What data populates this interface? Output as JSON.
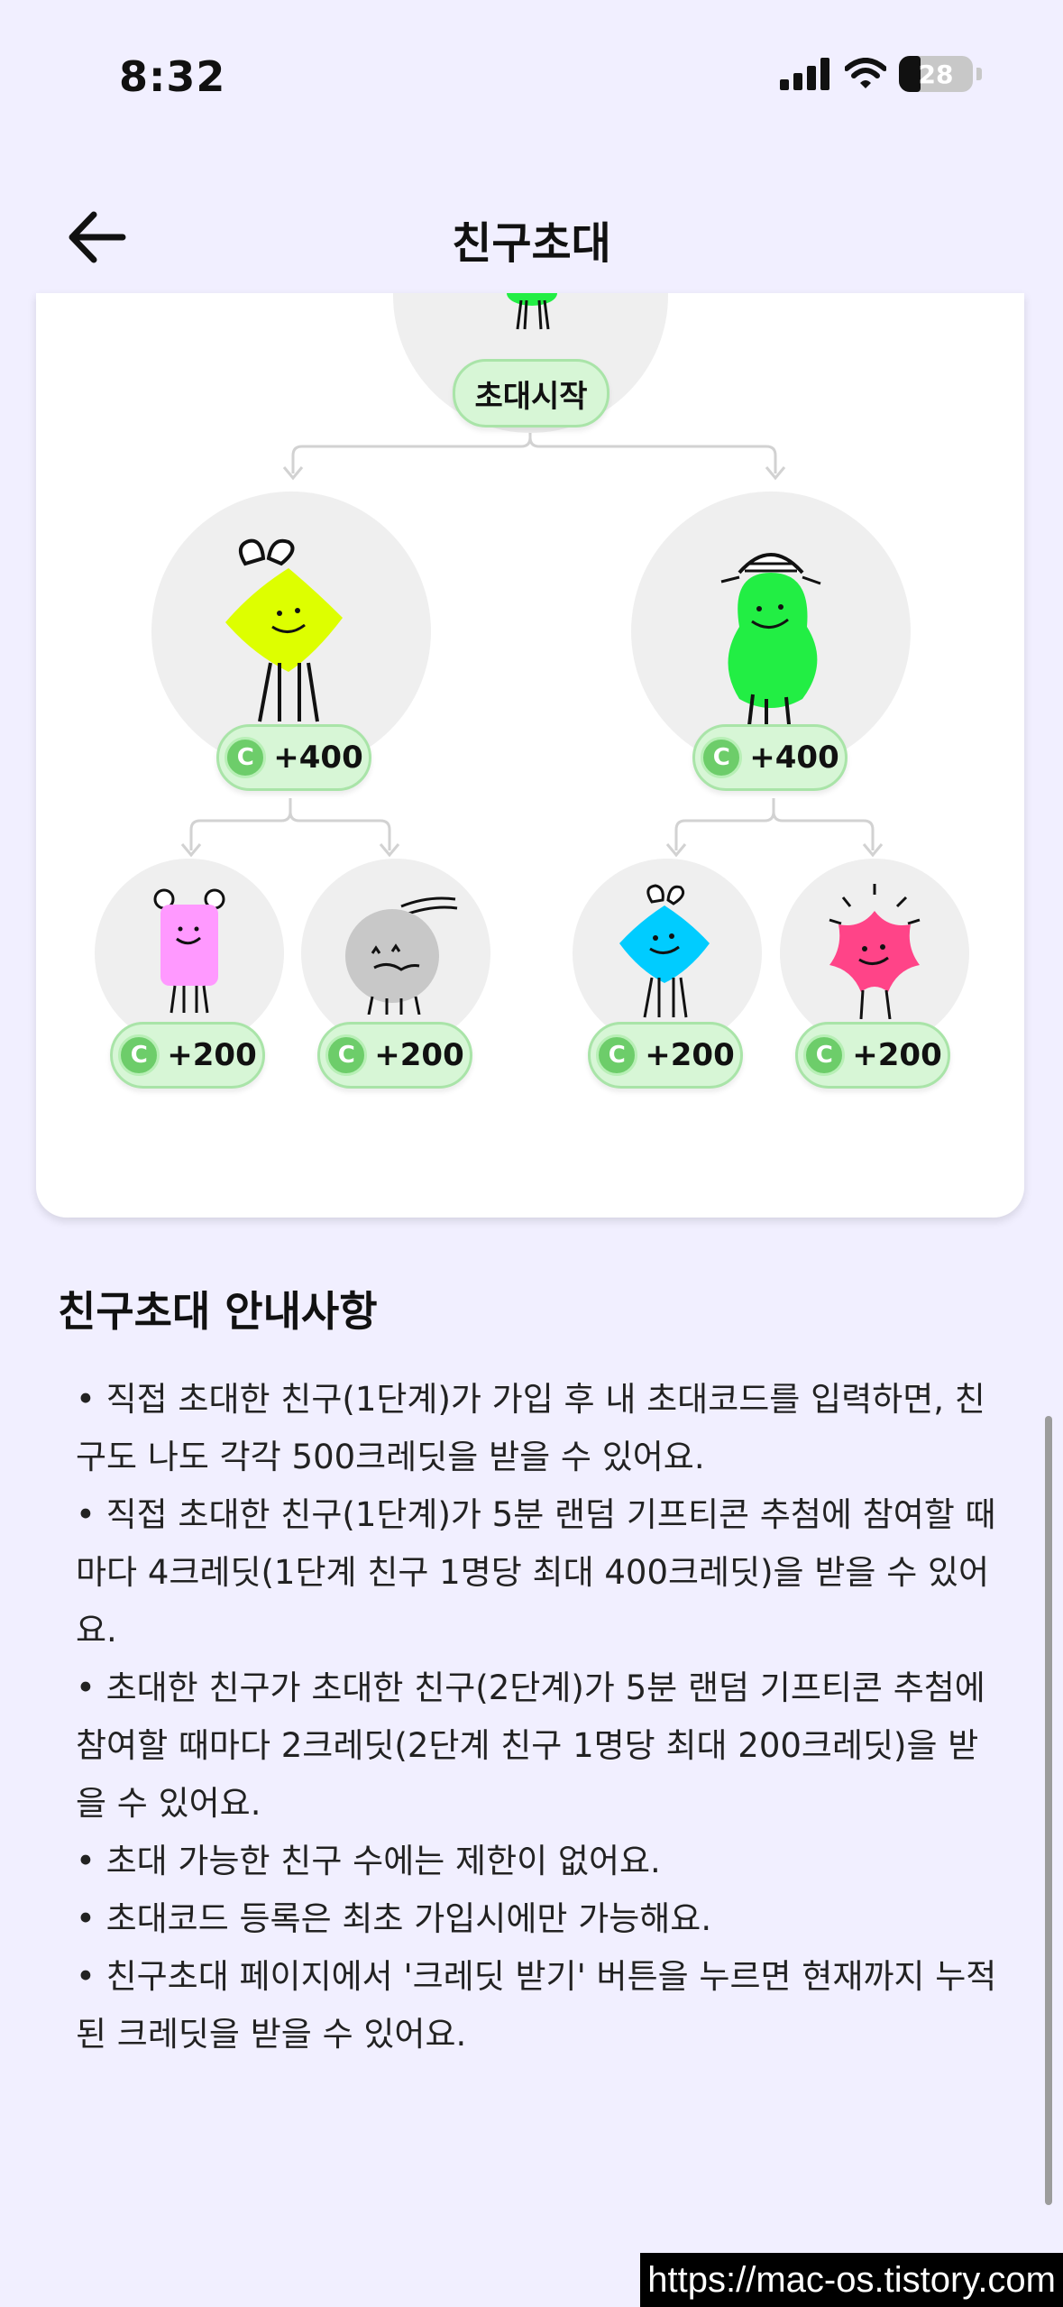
{
  "status_bar": {
    "time": "8:32",
    "battery": "28"
  },
  "header": {
    "title": "친구초대",
    "back_icon": "arrow-left-icon"
  },
  "tree": {
    "start_label": "초대시작",
    "level1": [
      {
        "reward": "+400",
        "character": "yellow-bow"
      },
      {
        "reward": "+400",
        "character": "green-hat"
      }
    ],
    "level2": [
      {
        "reward": "+200",
        "character": "pink-bear"
      },
      {
        "reward": "+200",
        "character": "gray-cloud"
      },
      {
        "reward": "+200",
        "character": "blue-bow"
      },
      {
        "reward": "+200",
        "character": "pink-star"
      }
    ],
    "coin_letter": "C"
  },
  "info": {
    "title": "친구초대 안내사항",
    "items": [
      "• 직접 초대한 친구(1단계)가 가입 후 내 초대코드를 입력하면, 친구도 나도 각각 500크레딧을 받을 수 있어요.",
      "• 직접 초대한 친구(1단계)가 5분 랜덤 기프티콘 추첨에 참여할 때마다 4크레딧(1단계 친구 1명당 최대 400크레딧)을 받을 수 있어요.",
      "• 초대한 친구가 초대한 친구(2단계)가 5분 랜덤 기프티콘 추첨에 참여할 때마다 2크레딧(2단계 친구 1명당 최대 200크레딧)을 받을 수 있어요.",
      "• 초대 가능한 친구 수에는 제한이 없어요.",
      "• 초대코드 등록은 최초 가입시에만 가능해요.",
      "• 친구초대 페이지에서 '크레딧 받기' 버튼을 누르면 현재까지 누적된 크레딧을 받을 수 있어요."
    ]
  },
  "watermark": "https://mac-os.tistory.com",
  "colors": {
    "background": "#f1efff",
    "badge": "#d7f6d6",
    "coin": "#6dcd6a"
  }
}
